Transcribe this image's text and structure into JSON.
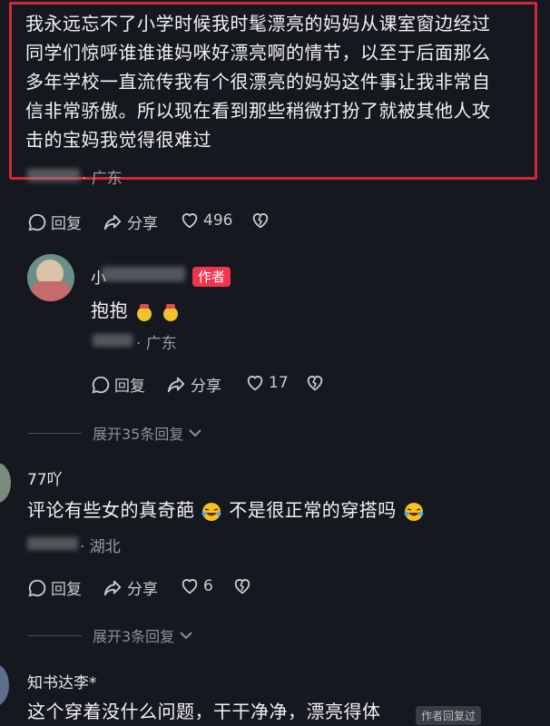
{
  "comment1": {
    "lines": [
      "我永远忘不了小学时候我时髦漂亮的妈妈从课室窗边经过",
      "同学们惊呼谁谁谁妈咪好漂亮啊的情节，以至于后面那么",
      "多年学校一直流传我有个很漂亮的妈妈这件事让我非常自",
      "信非常骄傲。所以现在看到那些稍微打扮了就被其他人攻",
      "击的宝妈我觉得很难过"
    ],
    "location": "· 广东",
    "reply_label": "回复",
    "share_label": "分享",
    "like_count": "496"
  },
  "reply1": {
    "username": "小",
    "badge": "作者",
    "text": "抱抱",
    "location": "· 广东",
    "reply_label": "回复",
    "share_label": "分享",
    "like_count": "17",
    "expand_label": "展开35条回复"
  },
  "comment2": {
    "username": "77吖",
    "text_a": "评论有些女的真奇葩",
    "text_b": "不是很正常的穿搭吗",
    "location": "· 湖北",
    "reply_label": "回复",
    "share_label": "分享",
    "like_count": "6",
    "expand_label": "展开3条回复"
  },
  "comment3": {
    "username": "知书达李*",
    "text": "这个穿着没什么问题，干干净净，漂亮得体",
    "author_replied": "作者回复过"
  },
  "colors": {
    "background": "#16181f",
    "highlight": "#d3263a",
    "badge": "#f0364f"
  }
}
